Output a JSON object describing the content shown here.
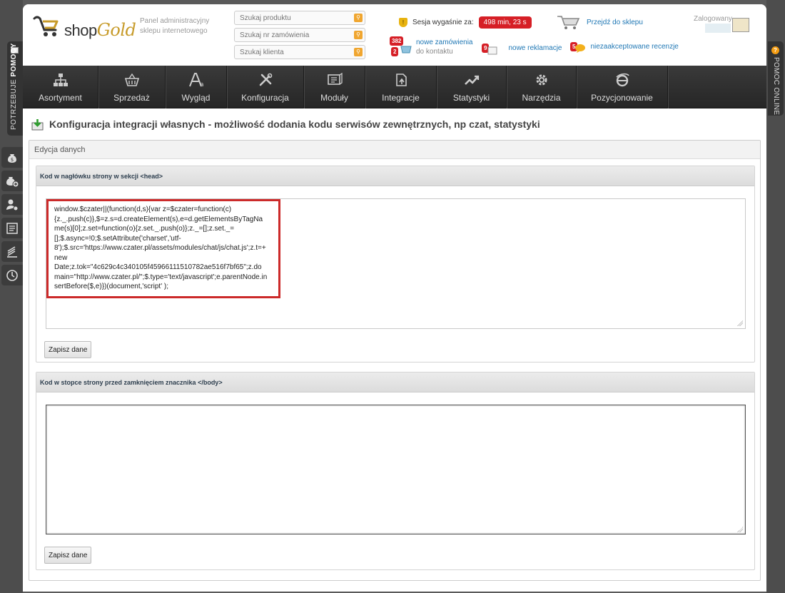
{
  "sidebar_left": {
    "help_tab": {
      "prefix": "POTRZEBUJE",
      "bold": "POMOCY"
    },
    "icons": [
      "money-bag-icon",
      "money-add-icon",
      "user-settings-icon",
      "list-icon",
      "stack-icon",
      "clock-icon"
    ]
  },
  "sidebar_right": {
    "online_tab": "POMOC ONLINE"
  },
  "header": {
    "logo": {
      "shop": "shop",
      "gold": "Gold"
    },
    "caption": "Panel administracyjny sklepu internetowego",
    "search": {
      "product_placeholder": "Szukaj produktu",
      "order_placeholder": "Szukaj nr zamówienia",
      "client_placeholder": "Szukaj klienta"
    },
    "session": {
      "label": "Sesja wygaśnie za:",
      "value": "498 min, 23 s"
    },
    "go_to_shop": "Przejdź do sklepu",
    "logged_label": "Zalogowany",
    "notifications": {
      "orders": {
        "count_top": "382",
        "count_bottom": "2",
        "label": "nowe zamówienia",
        "sub": "do kontaktu"
      },
      "complaints": {
        "count": "9",
        "label": "nowe reklamacje"
      },
      "reviews": {
        "count": "5",
        "label": "niezaakceptowane recenzje"
      }
    }
  },
  "nav": {
    "items": [
      {
        "label": "Asortyment",
        "icon": "hierarchy-icon"
      },
      {
        "label": "Sprzedaż",
        "icon": "basket-icon"
      },
      {
        "label": "Wygląd",
        "icon": "font-icon"
      },
      {
        "label": "Konfiguracja",
        "icon": "tools-icon"
      },
      {
        "label": "Moduły",
        "icon": "modules-icon"
      },
      {
        "label": "Integracje",
        "icon": "integration-icon"
      },
      {
        "label": "Statystyki",
        "icon": "chart-icon"
      },
      {
        "label": "Narzędzia",
        "icon": "gear-icon"
      },
      {
        "label": "Pozycjonowanie",
        "icon": "seo-icon"
      }
    ]
  },
  "page": {
    "title": "Konfiguracja integracji własnych - możliwość dodania kodu serwisów zewnętrznych, np czat, statystyki",
    "card_title": "Edycja danych",
    "head_section": {
      "title": "Kod w nagłówku strony w sekcji <head>",
      "code": "window.$czater||(function(d,s){var z=$czater=function(c)\n{z._.push(c)},$=z.s=d.createElement(s),e=d.getElementsByTagNa\nme(s)[0];z.set=function(o){z.set._.push(o)};z._=[];z.set._=\n[];$.async=!0;$.setAttribute('charset','utf-\n8');$.src='https://www.czater.pl/assets/modules/chat/js/chat.js';z.t=+\nnew\nDate;z.tok=\"4c629c4c340105f45966111510782ae516f7bf65\";z.do\nmain=\"http://www.czater.pl/\";$.type='text/javascript';e.parentNode.in\nsertBefore($,e)})(document,'script' );",
      "save_label": "Zapisz dane"
    },
    "footer_section": {
      "title": "Kod w stopce strony przed zamknięciem znacznika </body>",
      "code": "",
      "save_label": "Zapisz dane"
    }
  },
  "colors": {
    "accent_red": "#d61f26",
    "link_blue": "#1f77b4",
    "logo_gold": "#c79b2a",
    "nav_bg": "#2e2e2e"
  }
}
